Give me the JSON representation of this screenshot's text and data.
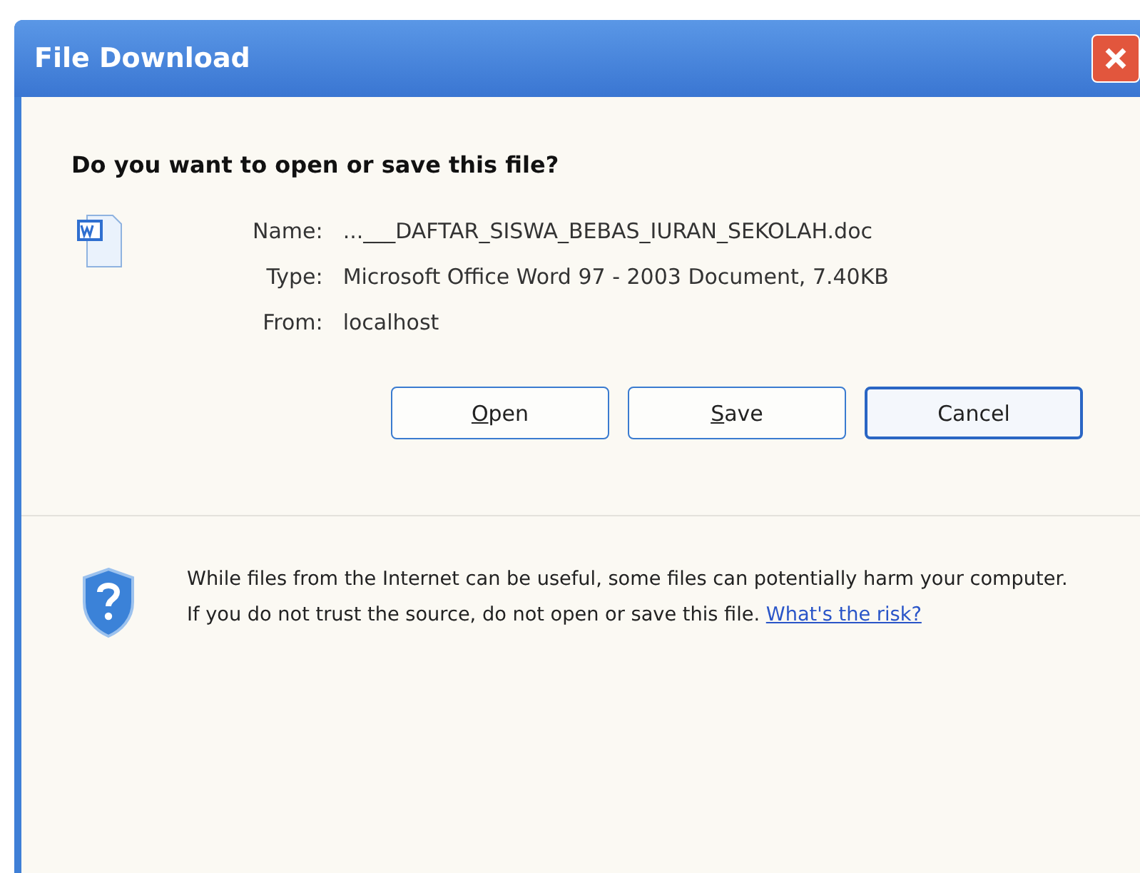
{
  "window": {
    "title": "File Download"
  },
  "question": "Do you want to open or save this file?",
  "file_info": [
    {
      "label": "Name:",
      "value": "...___DAFTAR_SISWA_BEBAS_IURAN_SEKOLAH.doc"
    },
    {
      "label": "Type:",
      "value": "Microsoft Office Word 97 - 2003 Document, 7.40KB"
    },
    {
      "label": "From:",
      "value": "localhost"
    }
  ],
  "buttons": [
    {
      "label": "Open",
      "underline_first": true,
      "focused": false
    },
    {
      "label": "Save",
      "underline_first": true,
      "focused": false
    },
    {
      "label": "Cancel",
      "underline_first": false,
      "focused": true
    }
  ],
  "warning": {
    "text": "While files from the Internet can be useful, some files can potentially harm your computer. If you do not trust the source, do not open or save this file.",
    "link": "What's the risk?"
  }
}
